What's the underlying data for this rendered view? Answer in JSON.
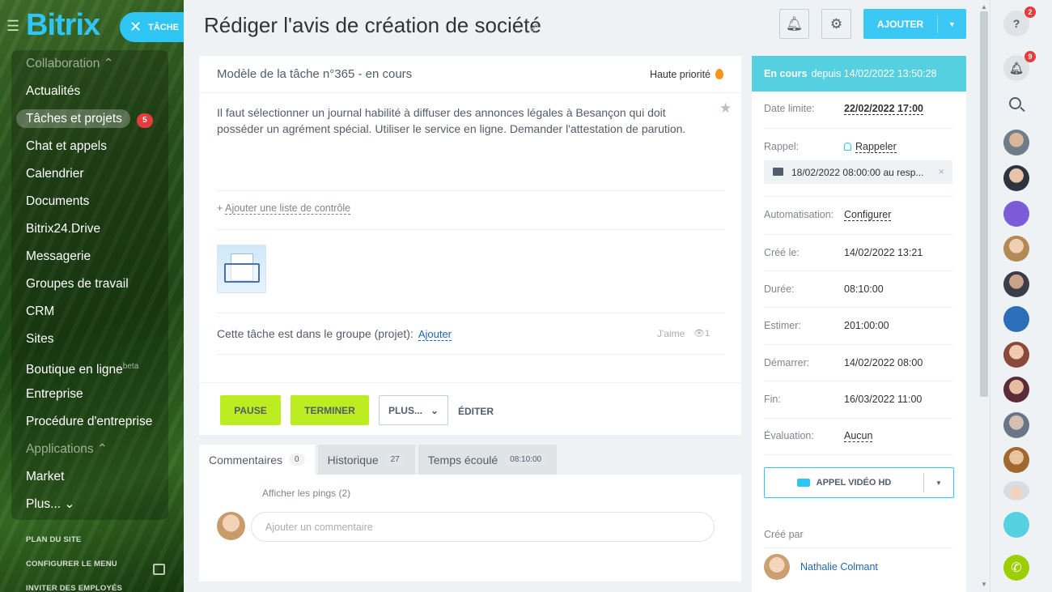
{
  "sidebar": {
    "logo": "Bitrix",
    "task_pill": "TÂCHE",
    "items": [
      {
        "label": "Collaboration ⌃",
        "type": "section"
      },
      {
        "label": "Actualités"
      },
      {
        "label": "Tâches et projets",
        "badge": "5",
        "active": true
      },
      {
        "label": "Chat et appels"
      },
      {
        "label": "Calendrier"
      },
      {
        "label": "Documents"
      },
      {
        "label": "Bitrix24.Drive"
      },
      {
        "label": "Messagerie"
      },
      {
        "label": "Groupes de travail"
      },
      {
        "label": "CRM"
      },
      {
        "label": "Sites"
      },
      {
        "label": "Boutique en ligne",
        "sup": "beta"
      },
      {
        "label": "Entreprise"
      },
      {
        "label": "Procédure d'entreprise"
      },
      {
        "label": "Applications ⌃",
        "type": "section"
      },
      {
        "label": "Market"
      },
      {
        "label": "Plus... ⌄"
      }
    ],
    "footer": [
      "PLAN DU SITE",
      "CONFIGURER LE MENU",
      "INVITER DES EMPLOYÉS"
    ]
  },
  "header": {
    "title": "Rédiger l'avis de création de société",
    "add_label": "AJOUTER"
  },
  "task": {
    "template_line": "Modèle de la tâche n°365 - en cours",
    "priority": "Haute priorité",
    "description": "Il faut sélectionner un journal habilité à diffuser des annonces légales à Besançon qui doit posséder un agrément spécial. Utiliser le service en ligne. Demander l'attestation de parution.",
    "checklist_plus": "+",
    "checklist_link": "Ajouter une liste de contrôle",
    "group_text": "Cette tâche est dans le groupe (projet):",
    "group_link": "Ajouter",
    "like": "J'aime",
    "views": "1",
    "buttons": {
      "pause": "PAUSE",
      "finish": "TERMINER",
      "more": "PLUS...",
      "edit": "ÉDITER"
    }
  },
  "tabs": [
    {
      "label": "Commentaires",
      "count": "0"
    },
    {
      "label": "Historique",
      "count": "27"
    },
    {
      "label": "Temps écoulé",
      "count": "08:10:00"
    }
  ],
  "comments": {
    "pings": "Afficher les pings (2)",
    "placeholder": "Ajouter un commentaire"
  },
  "status": {
    "state": "En cours",
    "since": "depuis 14/02/2022 13:50:28"
  },
  "details": {
    "deadline_label": "Date limite:",
    "deadline": "22/02/2022 17:00",
    "reminder_label": "Rappel:",
    "reminder_link": "Rappeler",
    "reminder_item": "18/02/2022 08:00:00 au resp...",
    "automation_label": "Automatisation:",
    "automation_link": "Configurer",
    "created_label": "Créé le:",
    "created": "14/02/2022 13:21",
    "duration_label": "Durée:",
    "duration": "08:10:00",
    "estimate_label": "Estimer:",
    "estimate": "201:00:00",
    "start_label": "Démarrer:",
    "start": "14/02/2022 08:00",
    "end_label": "Fin:",
    "end": "16/03/2022 11:00",
    "rating_label": "Évaluation:",
    "rating": "Aucun",
    "video_call": "APPEL VIDÉO HD",
    "created_by_label": "Créé par",
    "author": "Nathalie Colmant"
  },
  "rail": {
    "help_badge": "2",
    "notif_badge": "9"
  },
  "colors": {
    "accent": "#2fc6f6",
    "status": "#55d0e0",
    "green_button": "#bbed21",
    "badge": "#e83b3b"
  }
}
